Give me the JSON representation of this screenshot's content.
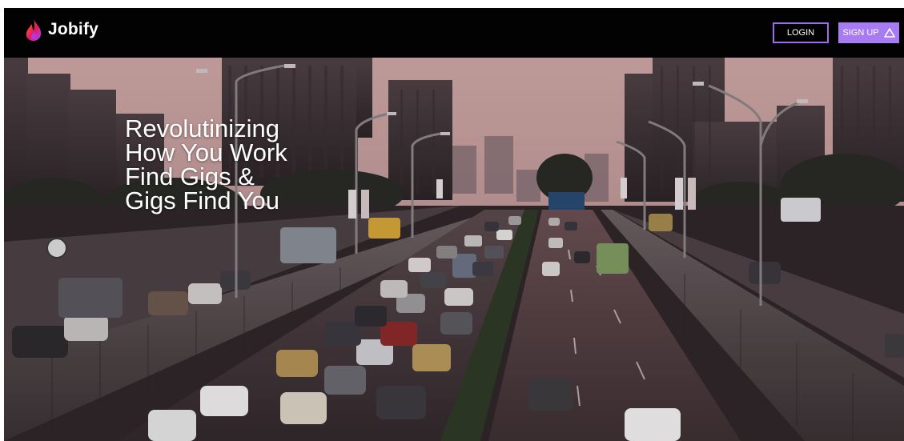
{
  "brand": {
    "name": "Jobify",
    "logo_icon": "flame-icon",
    "logo_colors": [
      "#ff7a1a",
      "#e8175d",
      "#9b4dff"
    ]
  },
  "nav": {
    "login_label": "LOGIN",
    "signup_label": "SIGN UP",
    "signup_icon": "triangle-icon"
  },
  "hero": {
    "headline_lines": [
      "Revolutinizing",
      "How You Work",
      "Find Gigs &",
      "Gigs Find You"
    ],
    "background": "city-highway-traffic-photo"
  },
  "colors": {
    "navbar_bg": "#020202",
    "accent_purple": "#a77cf2",
    "login_border": "#9b6bf0",
    "sky": "#c9a3a1"
  }
}
